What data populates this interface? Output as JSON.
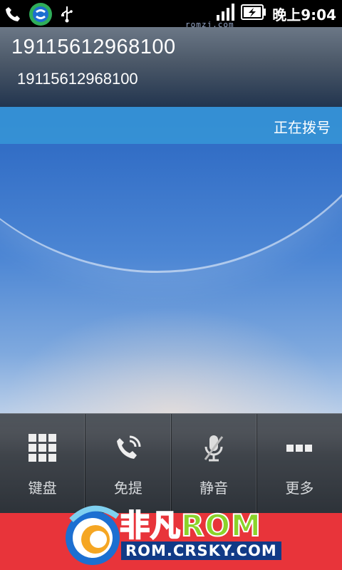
{
  "status_bar": {
    "time": "晚上9:04",
    "icons": [
      "phone-icon",
      "app-icon",
      "usb-icon",
      "signal-icon",
      "battery-icon"
    ],
    "watermark": "romzj.com"
  },
  "caller": {
    "number_primary": "19115612968100",
    "number_secondary": "19115612968100"
  },
  "call_state": "正在拨号",
  "controls": [
    {
      "label": "键盘",
      "icon": "keypad-icon"
    },
    {
      "label": "免提",
      "icon": "speaker-icon"
    },
    {
      "label": "静音",
      "icon": "mute-icon"
    },
    {
      "label": "更多",
      "icon": "more-icon"
    }
  ],
  "banner": {
    "title_part1": "非凡",
    "title_part2": "ROM",
    "url": "ROM.CRSKY.COM"
  },
  "colors": {
    "accent": "#3696d7",
    "banner": "#e8343a"
  }
}
